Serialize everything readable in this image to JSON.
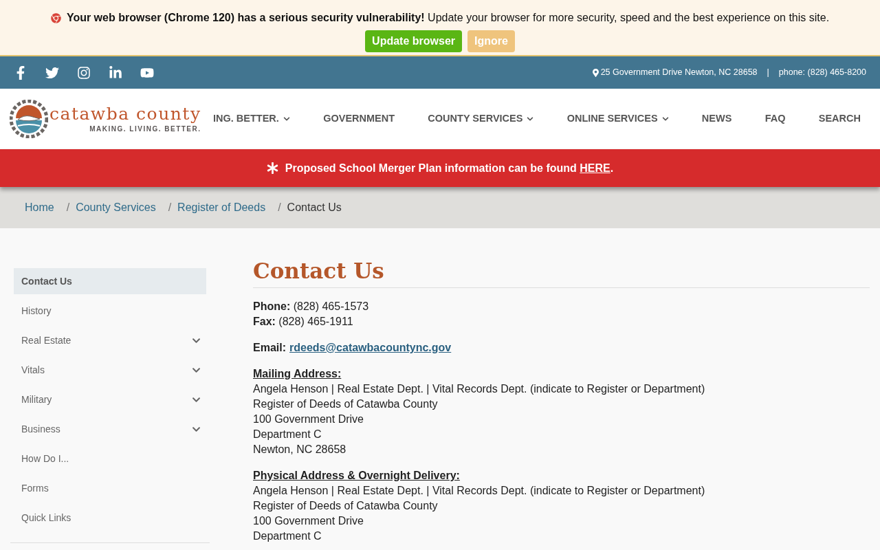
{
  "browser_notice": {
    "message": "**Your web browser (Chrome 120) has a serious security vulnerability!** Update your browser for more security, speed and the best experience on this site.",
    "buttons": [
      {
        "label": "Update browser",
        "kind": "primary"
      },
      {
        "label": "Ignore",
        "kind": "secondary"
      }
    ]
  },
  "top_bar": {
    "social": [
      {
        "kind": "facebook"
      },
      {
        "kind": "twitter"
      },
      {
        "kind": "instagram"
      },
      {
        "kind": "linkedin"
      },
      {
        "kind": "youtube"
      }
    ],
    "address": "25 Government Drive Newton, NC 28658",
    "separator": "|",
    "phone": "phone: (828) 465-8200"
  },
  "header": {
    "logo_name": "catawba county",
    "logo_tagline": "MAKING. LIVING. BETTER.",
    "nav": [
      {
        "label": "ING. BETTER.",
        "has_menu": true
      },
      {
        "label": "GOVERNMENT",
        "has_menu": false
      },
      {
        "label": "COUNTY SERVICES",
        "has_menu": true
      },
      {
        "label": "ONLINE SERVICES",
        "has_menu": true
      },
      {
        "label": "NEWS",
        "has_menu": false
      },
      {
        "label": "FAQ",
        "has_menu": false
      },
      {
        "label": "SEARCH",
        "has_menu": false
      }
    ]
  },
  "alert": {
    "text": "Proposed School Merger Plan information can be found",
    "link": "HERE",
    "end": "."
  },
  "breadcrumb": [
    {
      "label": "Home",
      "link": true
    },
    {
      "separator": "/",
      "label": "County Services",
      "link": true
    },
    {
      "separator": "/",
      "label": "Register of Deeds",
      "link": true
    },
    {
      "separator": "/",
      "label": "Contact Us",
      "link": false
    }
  ],
  "sidebar": {
    "items": [
      {
        "label": "Contact Us",
        "selected": true,
        "has_submenu": false
      },
      {
        "label": "History",
        "selected": false,
        "has_submenu": false
      },
      {
        "label": "Real Estate",
        "selected": false,
        "has_submenu": true
      },
      {
        "label": "Vitals",
        "selected": false,
        "has_submenu": true
      },
      {
        "label": "Military",
        "selected": false,
        "has_submenu": true
      },
      {
        "label": "Business",
        "selected": false,
        "has_submenu": true
      },
      {
        "label": "How Do I...",
        "selected": false,
        "has_submenu": false
      },
      {
        "label": "Forms",
        "selected": false,
        "has_submenu": false
      },
      {
        "label": "Quick Links",
        "selected": false,
        "has_submenu": false
      }
    ]
  },
  "content": {
    "title": "Contact Us",
    "blocks": [
      {
        "kind": "lines",
        "lines": [
          "**Phone:** (828) 465-1573",
          "**Fax:** (828) 465-1911"
        ]
      },
      {
        "kind": "email",
        "label": "Email:",
        "link": "rdeeds@catawbacountync.gov"
      },
      {
        "kind": "address",
        "heading": "Mailing Address:",
        "lines": [
          "Angela Henson | Real Estate Dept. | Vital Records Dept. (indicate to Register or Department)",
          "Register of Deeds of Catawba County",
          "100 Government Drive",
          "Department C",
          "Newton, NC 28658"
        ]
      },
      {
        "kind": "address",
        "heading": "Physical Address & Overnight Delivery:",
        "lines": [
          "Angela Henson | Real Estate Dept. | Vital Records Dept. (indicate to Register or Department)",
          "Register of Deeds of Catawba County",
          "100 Government Drive",
          "Department C"
        ]
      }
    ]
  }
}
